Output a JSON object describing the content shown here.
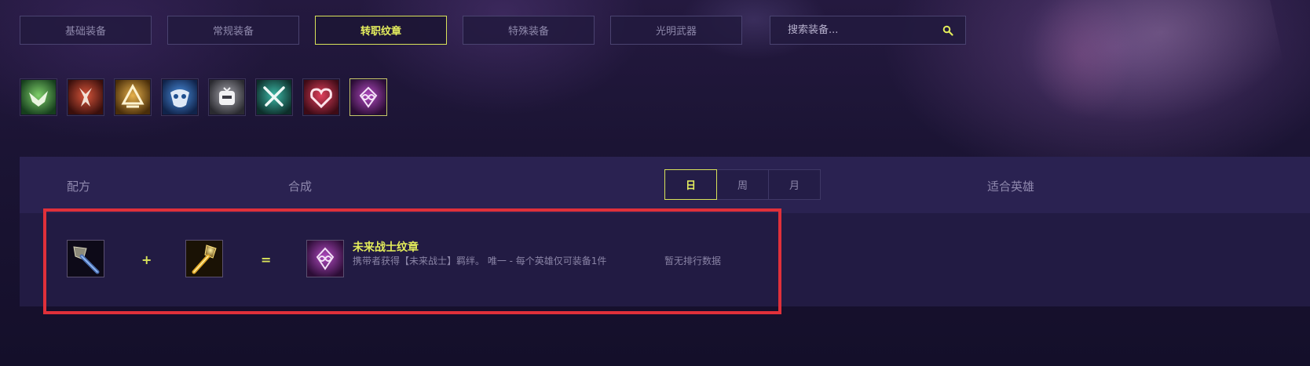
{
  "tabs": [
    {
      "label": "基础装备",
      "active": false
    },
    {
      "label": "常规装备",
      "active": false
    },
    {
      "label": "转职纹章",
      "active": true
    },
    {
      "label": "特殊装备",
      "active": false
    },
    {
      "label": "光明武器",
      "active": false
    }
  ],
  "search": {
    "placeholder": "搜索装备...",
    "icon": "search-icon"
  },
  "emblems": [
    {
      "icon": "green-bird-emblem-icon",
      "color": "#2f7a3a"
    },
    {
      "icon": "red-flame-emblem-icon",
      "color": "#8a2a22"
    },
    {
      "icon": "gold-chevron-emblem-icon",
      "color": "#a8741f"
    },
    {
      "icon": "blue-mask-emblem-icon",
      "color": "#1f4f8f"
    },
    {
      "icon": "gray-robot-emblem-icon",
      "color": "#6a6a72"
    },
    {
      "icon": "teal-swords-emblem-icon",
      "color": "#1c6a62"
    },
    {
      "icon": "red-heart-emblem-icon",
      "color": "#9a2238"
    },
    {
      "icon": "purple-infinity-emblem-icon",
      "color": "#7a2a8a",
      "active": true
    }
  ],
  "table": {
    "headers": {
      "recipe": "配方",
      "compose": "合成",
      "heroes": "适合英雄"
    },
    "period": [
      {
        "label": "日",
        "active": true
      },
      {
        "label": "周",
        "active": false
      },
      {
        "label": "月",
        "active": false
      }
    ],
    "row": {
      "ingredient_1_icon": "spatula-icon",
      "plus": "+",
      "ingredient_2_icon": "golden-spatula-icon",
      "equals": "=",
      "result_icon": "future-warrior-emblem-icon",
      "result_name": "未来战士纹章",
      "result_desc": "携带者获得【未来战士】羁绊。 唯一 - 每个英雄仅可装备1件",
      "no_data": "暂无排行数据"
    }
  },
  "colors": {
    "accent": "#e3ec5a",
    "highlight_border": "#e0303a",
    "header_bg": "#2a2251",
    "row_bg": "#221b43"
  }
}
